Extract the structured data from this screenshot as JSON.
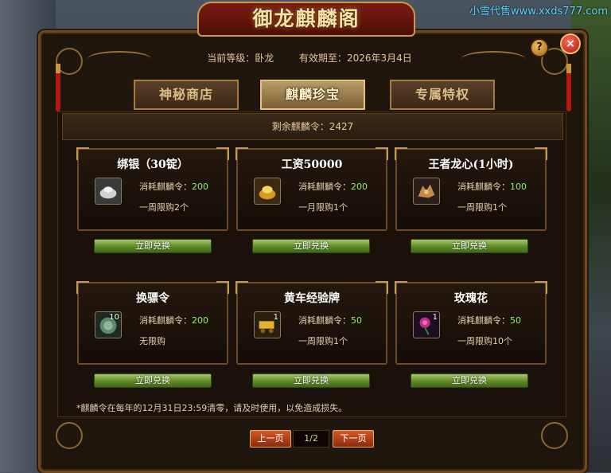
{
  "watermark": "小雪代售www.xxds777.com",
  "window": {
    "title": "御龙麒麟阁",
    "help_label": "?",
    "close_label": "×"
  },
  "info": {
    "level_label": "当前等级：",
    "level_value": "卧龙",
    "expiry_label": "有效期至：",
    "expiry_value": "2026年3月4日"
  },
  "tabs": [
    {
      "label": "神秘商店",
      "active": false
    },
    {
      "label": "麒麟珍宝",
      "active": true
    },
    {
      "label": "专属特权",
      "active": false
    }
  ],
  "remaining": {
    "label": "剩余麒麟令：",
    "value": "2427"
  },
  "items": [
    {
      "name": "绑银（30锭）",
      "icon": "silver-ingot-icon",
      "qty": "",
      "cost_label": "消耗麒麟令：",
      "cost": "200",
      "limit": "一周限购2个",
      "button": "立即兑换"
    },
    {
      "name": "工资50000",
      "icon": "gold-ingot-icon",
      "qty": "",
      "cost_label": "消耗麒麟令：",
      "cost": "200",
      "limit": "一月限购1个",
      "button": "立即兑换"
    },
    {
      "name": "王者龙心(1小时)",
      "icon": "dragon-heart-icon",
      "qty": "",
      "cost_label": "消耗麒麟令：",
      "cost": "100",
      "limit": "一周限购1个",
      "button": "立即兑换"
    },
    {
      "name": "换骠令",
      "icon": "token-icon",
      "qty": "10",
      "cost_label": "消耗麒麟令：",
      "cost": "200",
      "limit": "无限购",
      "button": "立即兑换"
    },
    {
      "name": "黄车经验牌",
      "icon": "gold-cart-icon",
      "qty": "1",
      "cost_label": "消耗麒麟令：",
      "cost": "50",
      "limit": "一周限购1个",
      "button": "立即兑换"
    },
    {
      "name": "玫瑰花",
      "icon": "rose-icon",
      "qty": "1",
      "cost_label": "消耗麒麟令：",
      "cost": "50",
      "limit": "一周限购10个",
      "button": "立即兑换"
    }
  ],
  "footnote": "*麒麟令在每年的12月31日23:59清零，请及时使用，以免造成损失。",
  "pagination": {
    "prev": "上一页",
    "page": "1/2",
    "next": "下一页"
  },
  "colors": {
    "accent_gold": "#e2c79a",
    "cost_green": "#8ff06e",
    "button_green": "#5f8a2a",
    "pager_red": "#8a2a0e"
  }
}
